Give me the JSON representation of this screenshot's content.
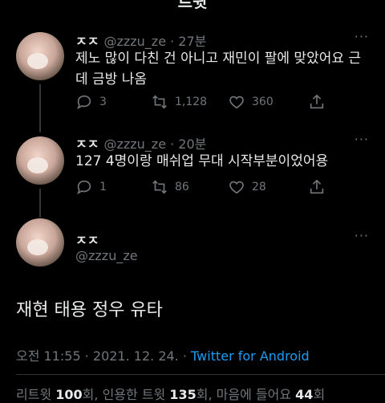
{
  "header": {
    "title": "트윗"
  },
  "thread": [
    {
      "author": "ㅈㅈ",
      "handle": "@zzzu_ze",
      "time": "27분",
      "text": "제노 많이 다친 건 아니고 재민이 팔에 맞았어요 근데 금방 나옴",
      "replies": "3",
      "retweets": "1,128",
      "likes": "360"
    },
    {
      "author": "ㅈㅈ",
      "handle": "@zzzu_ze",
      "time": "20분",
      "text": "127 4명이랑 매쉬업 무대 시작부분이었어용",
      "replies": "1",
      "retweets": "86",
      "likes": "28"
    }
  ],
  "main_tweet": {
    "author": "ㅈㅈ",
    "handle": "@zzzu_ze",
    "text": "재현 태용 정우 유타",
    "timestamp": "오전 11:55 · 2021. 12. 24. · ",
    "client": "Twitter for Android",
    "stats": {
      "retweets_label": "리트윗",
      "retweets": "100",
      "retweets_unit": "회",
      "quotes_label": "인용한 트윗",
      "quotes": "135",
      "quotes_unit": "회",
      "likes_label": "마음에 들어요",
      "likes": "44",
      "likes_unit": "회"
    }
  },
  "more_glyph": "···"
}
